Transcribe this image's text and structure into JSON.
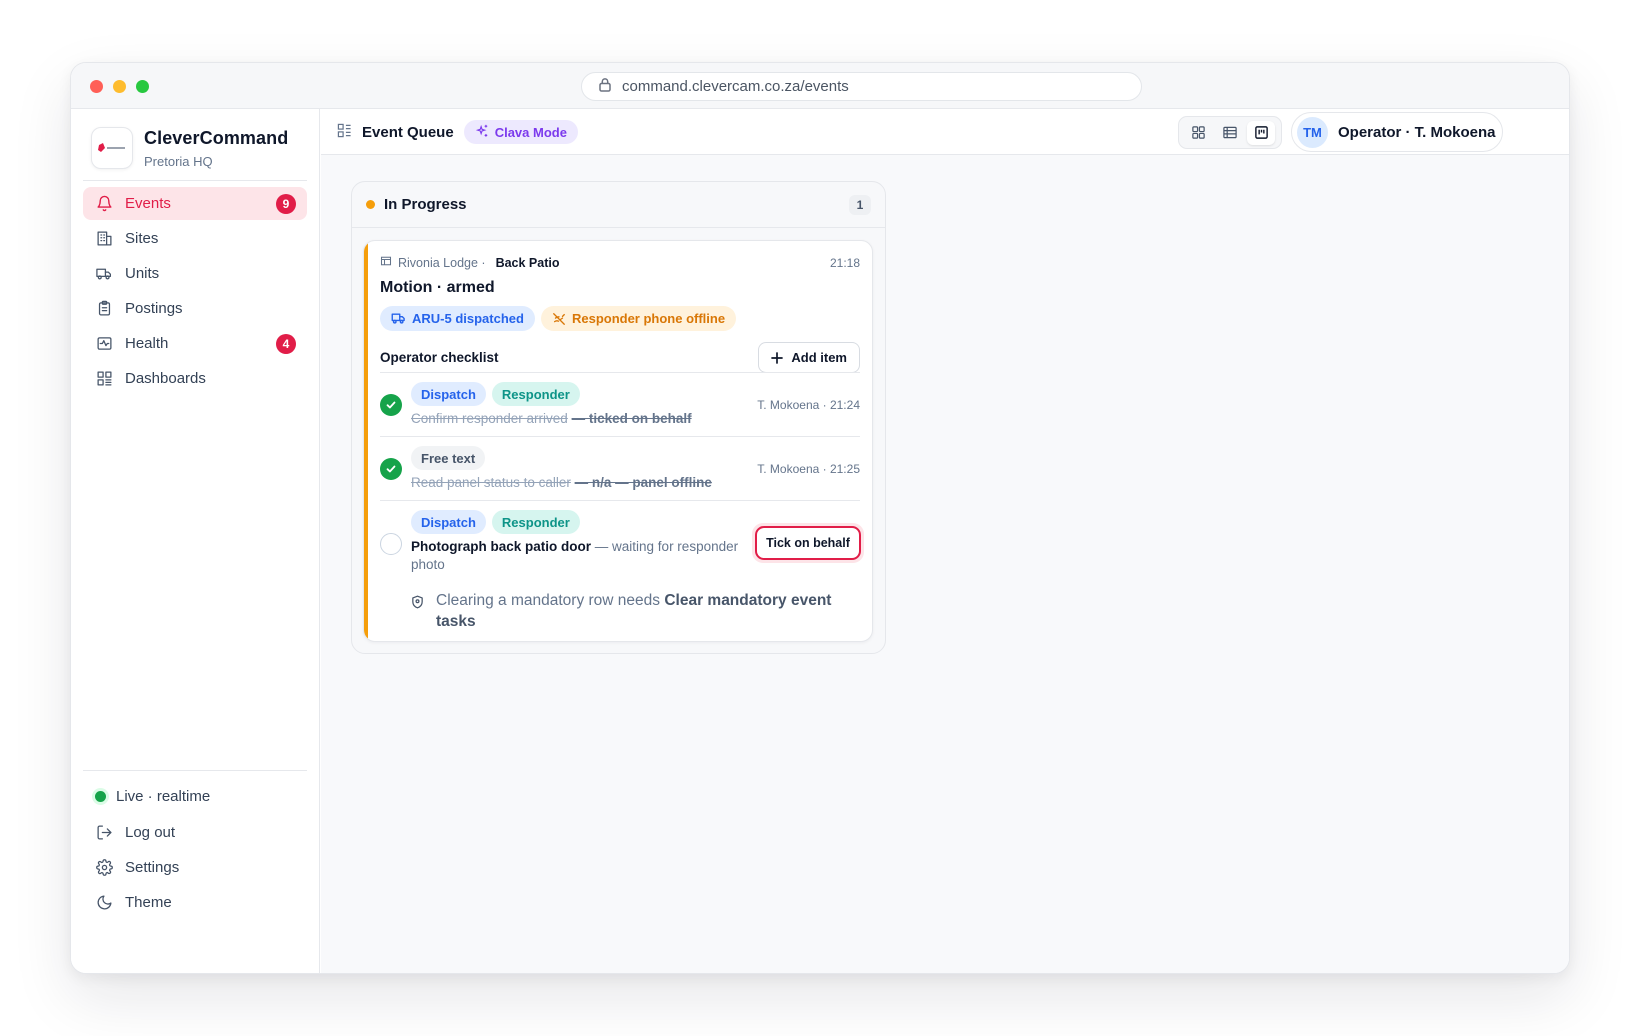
{
  "browser": {
    "url": "command.clevercam.co.za/events"
  },
  "brand": {
    "name": "CleverCommand",
    "location": "Pretoria HQ"
  },
  "nav": [
    {
      "label": "Events",
      "icon": "bell-icon",
      "badge": "9",
      "active": true
    },
    {
      "label": "Sites",
      "icon": "building-icon"
    },
    {
      "label": "Units",
      "icon": "truck-icon"
    },
    {
      "label": "Postings",
      "icon": "clipboard-icon"
    },
    {
      "label": "Health",
      "icon": "activity-icon",
      "badge": "4"
    },
    {
      "label": "Dashboards",
      "icon": "grid-icon"
    }
  ],
  "sidebar_bottom": {
    "live": "Live · realtime",
    "logout": "Log out",
    "settings": "Settings",
    "theme": "Theme"
  },
  "topbar": {
    "title": "Event Queue",
    "mode": "Clava Mode",
    "operator_initials": "TM",
    "operator": "Operator · T. Mokoena"
  },
  "column": {
    "title": "In Progress",
    "count": "1"
  },
  "card": {
    "site": "Rivonia Lodge ·",
    "zone": "Back Patio",
    "time": "21:18",
    "title": "Motion · armed",
    "chip_dispatch": "ARU-5 dispatched",
    "chip_offline": "Responder phone offline",
    "checklist_title": "Operator checklist",
    "add_item": "Add item",
    "rows": [
      {
        "tags": [
          "Dispatch",
          "Responder"
        ],
        "text": "Confirm responder arrived",
        "suffix": "— ticked on behalf",
        "who": "T. Mokoena · 21:24",
        "done": true
      },
      {
        "tags": [
          "Free text"
        ],
        "text": "Read panel status to caller",
        "suffix": "— n/a — panel offline",
        "who": "T. Mokoena · 21:25",
        "done": true
      },
      {
        "tags": [
          "Dispatch",
          "Responder"
        ],
        "text": "Photograph back patio door",
        "suffix": "— waiting for responder photo",
        "done": false,
        "action": "Tick on behalf"
      }
    ],
    "note_prefix": "Clearing a mandatory row needs",
    "note_strong": "Clear mandatory event tasks"
  },
  "colors": {
    "accent": "#e11d48",
    "progress": "#f59e0b",
    "done": "#16a34a"
  }
}
